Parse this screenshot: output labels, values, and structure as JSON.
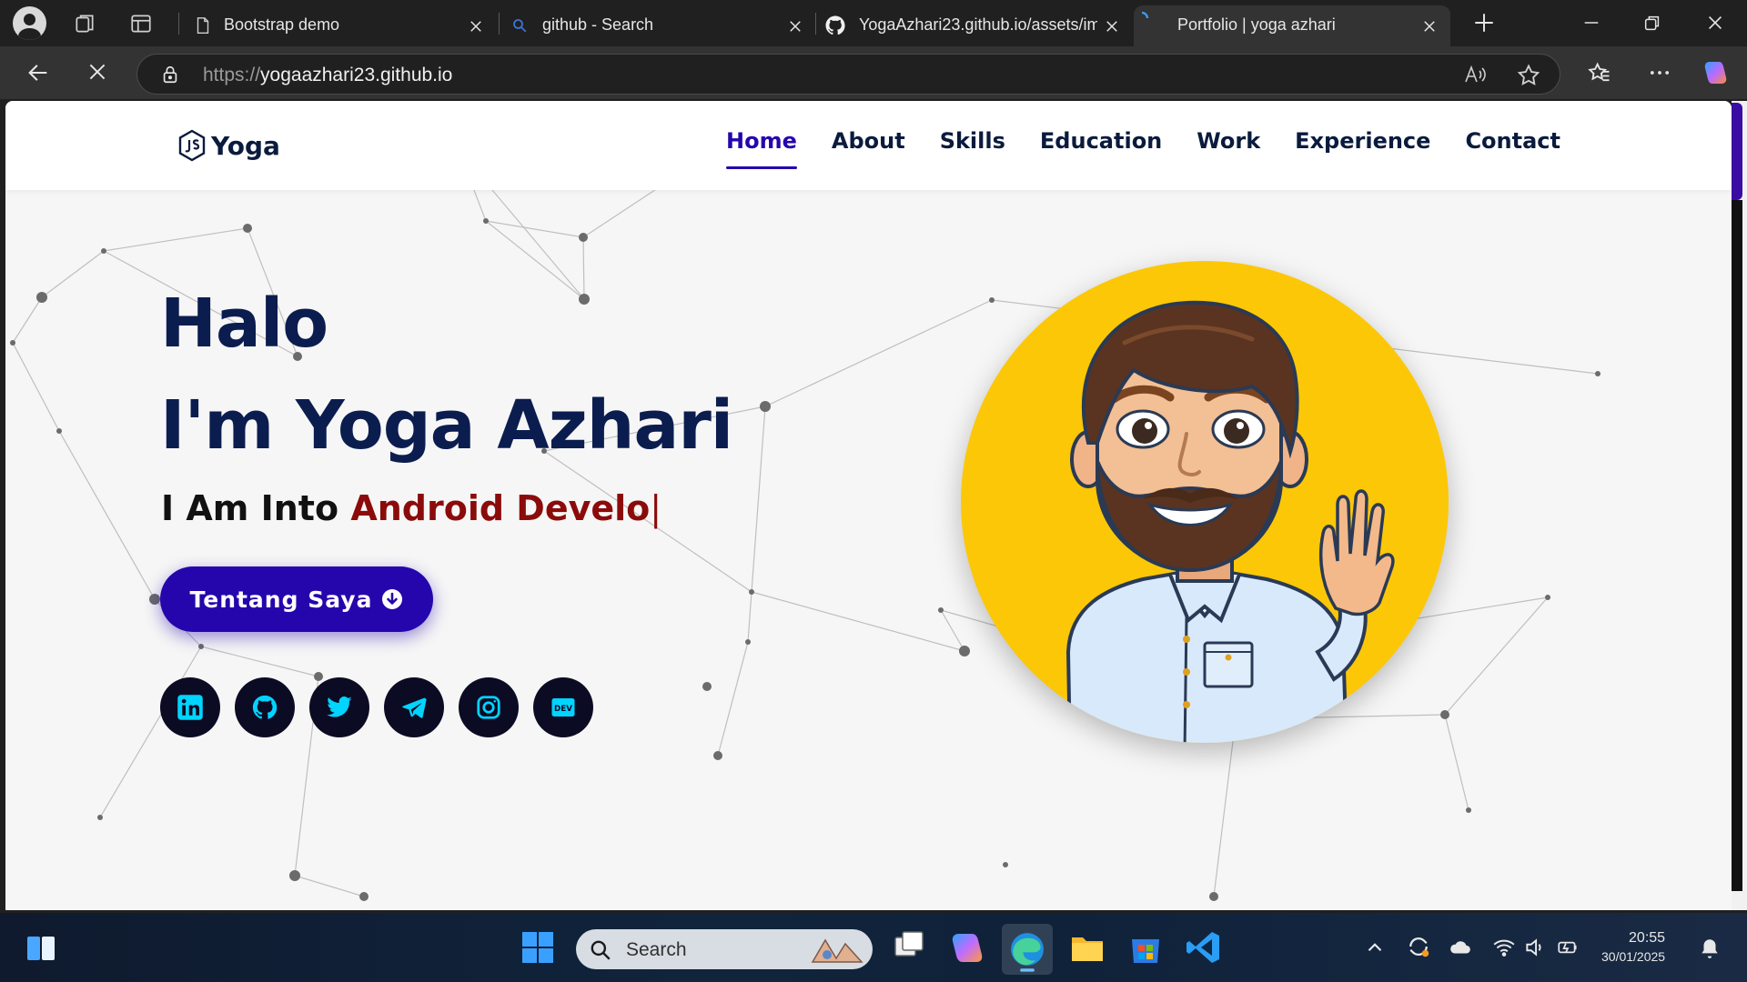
{
  "browser": {
    "tabs": [
      {
        "title": "Bootstrap demo",
        "favicon": "document-icon",
        "active": false
      },
      {
        "title": "github - Search",
        "favicon": "search-icon",
        "active": false
      },
      {
        "title": "YogaAzhari23.github.io/assets/im",
        "favicon": "github-icon",
        "active": false
      },
      {
        "title": "Portfolio | yoga azhari",
        "favicon": "loading-spinner-icon",
        "active": true
      }
    ],
    "address": {
      "scheme": "https://",
      "host": "yogaazhari23.github.io"
    }
  },
  "page": {
    "brand": {
      "text": "Yoga",
      "icon": "nodejs-icon"
    },
    "nav": [
      "Home",
      "About",
      "Skills",
      "Education",
      "Work",
      "Experience",
      "Contact"
    ],
    "nav_active": "Home",
    "hero": {
      "line1": "Halo",
      "line2": "I'm Yoga Azhari",
      "typing_prefix": "I Am Into",
      "typing_text": "Android Develo",
      "cursor": "|"
    },
    "cta": {
      "label": "Tentang Saya",
      "icon": "arrow-circle-down-icon"
    },
    "socials": [
      "linkedin-icon",
      "github-icon",
      "twitter-icon",
      "telegram-icon",
      "instagram-icon",
      "dev-icon"
    ],
    "colors": {
      "primary": "#2506ad",
      "heading": "#0b1d4f",
      "typed_text": "#8b0b0b",
      "avatar_bg": "#fcc707",
      "social_bg": "#0c0b24",
      "social_icon": "#00d4ff"
    }
  },
  "taskbar": {
    "search_label": "Search",
    "time": "20:55",
    "date": "30/01/2025"
  }
}
